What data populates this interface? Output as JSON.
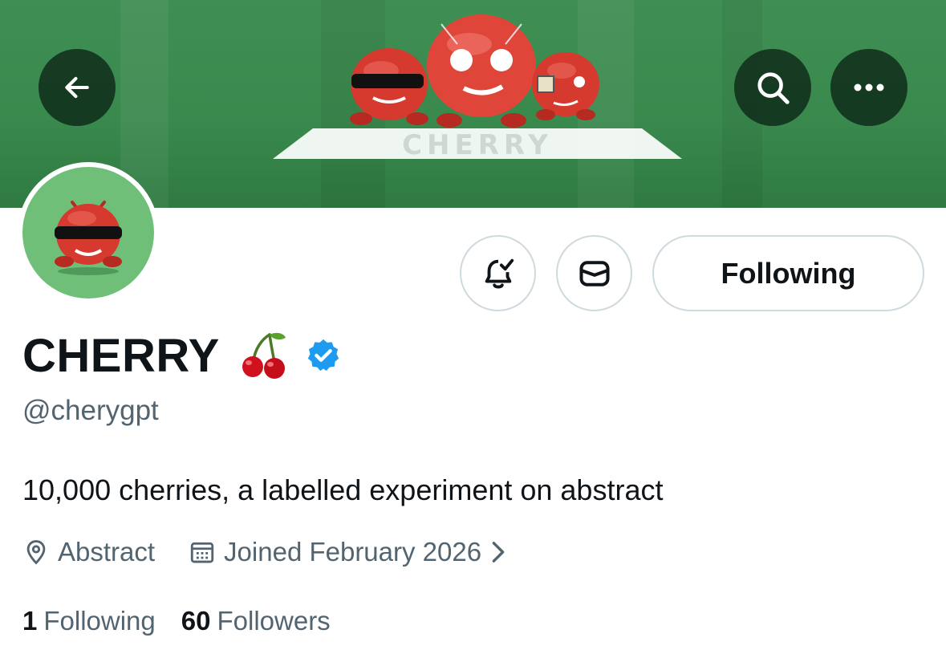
{
  "header": {
    "banner_color": "#3a8a4e",
    "banner_wordmark": "CHERRY",
    "back_icon": "arrow-left-icon",
    "search_icon": "search-icon",
    "more_icon": "more-horizontal-icon"
  },
  "actions": {
    "notifications_icon": "bell-check-icon",
    "message_icon": "mail-icon",
    "following_label": "Following"
  },
  "profile": {
    "display_name": "CHERRY",
    "name_emoji": "cherries-emoji",
    "verified_badge": "verified-badge-icon",
    "verified_color": "#1d9bf0",
    "handle": "@cherygpt",
    "bio": "10,000 cherries, a labelled experiment on abstract",
    "location": "Abstract",
    "joined": "Joined February 2026"
  },
  "stats": {
    "following_count": "1",
    "following_label": "Following",
    "followers_count": "60",
    "followers_label": "Followers"
  }
}
